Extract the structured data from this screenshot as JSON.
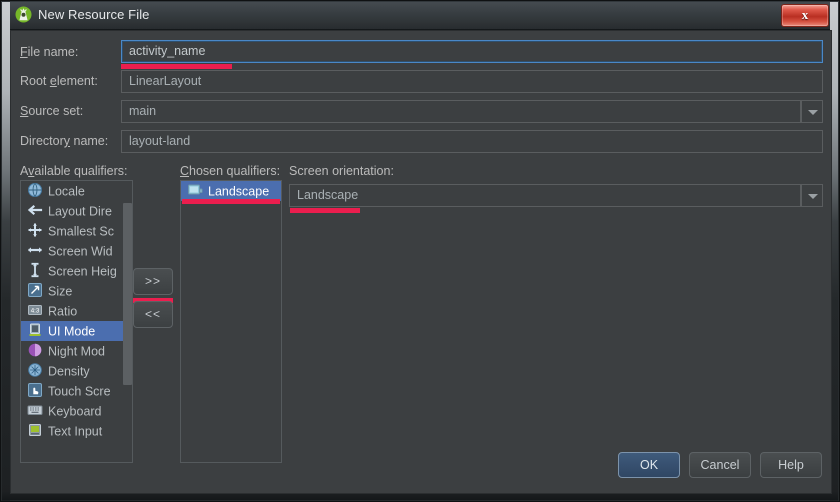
{
  "window": {
    "title": "New Resource File",
    "app_icon": "android-studio-icon",
    "close_label": "x"
  },
  "form": {
    "file_name": {
      "label_pre": "",
      "label_mnemonic": "F",
      "label_post": "ile name:",
      "value": "activity_name",
      "focused": true
    },
    "root_element": {
      "label_pre": "Root ",
      "label_mnemonic": "e",
      "label_post": "lement:",
      "value": "LinearLayout"
    },
    "source_set": {
      "label_pre": "",
      "label_mnemonic": "S",
      "label_post": "ource set:",
      "value": "main"
    },
    "directory_name": {
      "label_pre": "Director",
      "label_mnemonic": "y",
      "label_post": " name:",
      "value": "layout-land"
    }
  },
  "qualifiers": {
    "available_label_pre": "A",
    "available_label_mnemonic": "v",
    "available_label_post": "ailable qualifiers:",
    "chosen_label_pre": "",
    "chosen_label_mnemonic": "C",
    "chosen_label_post": "hosen qualifiers:",
    "available": [
      {
        "label": "Locale",
        "icon": "globe-icon",
        "selected": false
      },
      {
        "label": "Layout Dire",
        "icon": "layout-direction-icon",
        "selected": false
      },
      {
        "label": "Smallest Sc",
        "icon": "smallest-screen-width-icon",
        "selected": false
      },
      {
        "label": "Screen Wid",
        "icon": "screen-width-icon",
        "selected": false
      },
      {
        "label": "Screen Heig",
        "icon": "screen-height-icon",
        "selected": false
      },
      {
        "label": "Size",
        "icon": "size-icon",
        "selected": false
      },
      {
        "label": "Ratio",
        "icon": "ratio-icon",
        "selected": false
      },
      {
        "label": "UI Mode",
        "icon": "ui-mode-icon",
        "selected": true
      },
      {
        "label": "Night Mod",
        "icon": "night-mode-icon",
        "selected": false
      },
      {
        "label": "Density",
        "icon": "density-icon",
        "selected": false
      },
      {
        "label": "Touch Scre",
        "icon": "touch-screen-icon",
        "selected": false
      },
      {
        "label": "Keyboard",
        "icon": "keyboard-icon",
        "selected": false
      },
      {
        "label": "Text Input",
        "icon": "text-input-icon",
        "selected": false
      }
    ],
    "chosen": [
      {
        "label": "Landscape",
        "icon": "landscape-icon",
        "selected": true
      }
    ],
    "add_button": ">>",
    "remove_button": "<<"
  },
  "orientation": {
    "label": "Screen orientation:",
    "value": "Landscape"
  },
  "footer": {
    "ok": "OK",
    "cancel": "Cancel",
    "help": "Help"
  },
  "colors": {
    "dialog_bg": "#3c3f41",
    "accent_selection": "#4b6eaf",
    "annotation_red": "#eb1e4e",
    "focus_border": "#4a88c7",
    "close_red": "#b92f22"
  }
}
